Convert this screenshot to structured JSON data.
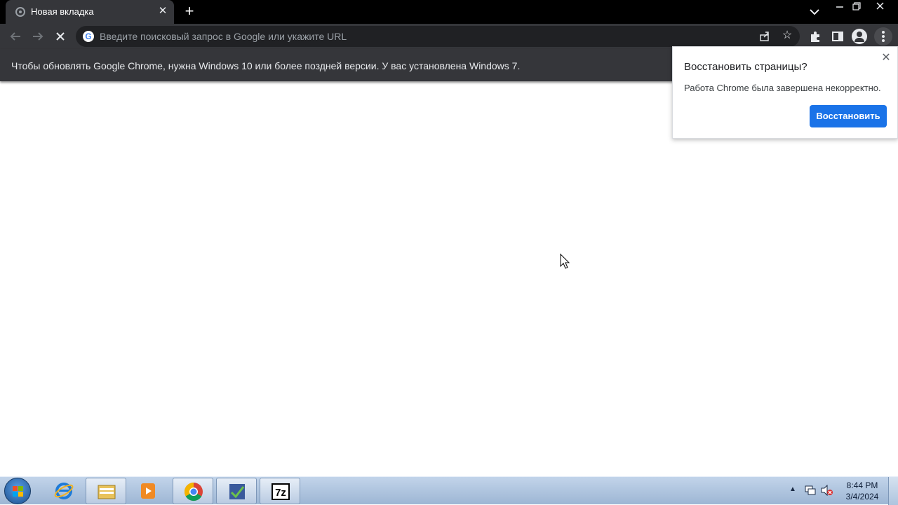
{
  "browser": {
    "tab_title": "Новая вкладка",
    "omnibox_placeholder": "Введите поисковый запрос в Google или укажите URL",
    "icons": [
      "back-arrow-icon",
      "forward-arrow-icon",
      "stop-loading-icon",
      "google-g-icon",
      "share-icon",
      "star-icon",
      "extensions-icon",
      "side-panel-icon",
      "profile-icon",
      "more-menu-icon"
    ]
  },
  "infobar": {
    "message": "Чтобы обновлять Google Chrome, нужна Windows 10 или более поздней версии. У вас установлена Windows 7."
  },
  "restore_bubble": {
    "title": "Восстановить страницы?",
    "message": "Работа Chrome была завершена некорректно.",
    "button_label": "Восстановить",
    "button_color": "#1a73e8"
  },
  "taskbar": {
    "items": [
      "internet-explorer",
      "windows-explorer",
      "media-player",
      "google-chrome",
      "app",
      "7-zip"
    ],
    "time": "8:44 PM",
    "date": "3/4/2024"
  },
  "colors": {
    "tabstrip": "#000000",
    "toolbar": "#35363a",
    "taskbar": "#9db6d4"
  }
}
